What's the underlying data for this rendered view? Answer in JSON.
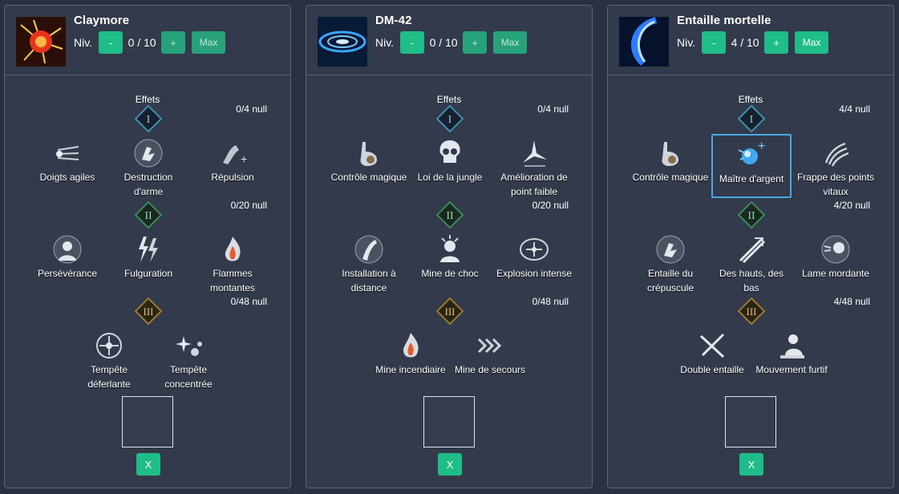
{
  "panels": [
    {
      "name": "Claymore",
      "level_label": "Niv.",
      "level": "0 / 10",
      "minus": "-",
      "plus": "+",
      "max": "Max",
      "effects": "Effets",
      "tiers": [
        {
          "numeral": "I",
          "count": "0/4 null",
          "options": [
            "Doigts agiles",
            "Destruction d'arme",
            "Répulsion"
          ]
        },
        {
          "numeral": "II",
          "count": "0/20 null",
          "options": [
            "Persévérance",
            "Fulguration",
            "Flammes montantes"
          ]
        },
        {
          "numeral": "III",
          "count": "0/48 null",
          "options": [
            "Tempête déferlante",
            "Tempête concentrée"
          ]
        }
      ],
      "clear": "X"
    },
    {
      "name": "DM-42",
      "level_label": "Niv.",
      "level": "0 / 10",
      "minus": "-",
      "plus": "+",
      "max": "Max",
      "effects": "Effets",
      "tiers": [
        {
          "numeral": "I",
          "count": "0/4 null",
          "options": [
            "Contrôle magique",
            "Loi de la jungle",
            "Amélioration de point faible"
          ]
        },
        {
          "numeral": "II",
          "count": "0/20 null",
          "options": [
            "Installation à distance",
            "Mine de choc",
            "Explosion intense"
          ]
        },
        {
          "numeral": "III",
          "count": "0/48 null",
          "options": [
            "Mine incendiaire",
            "Mine de secours"
          ]
        }
      ],
      "clear": "X"
    },
    {
      "name": "Entaille mortelle",
      "level_label": "Niv.",
      "level": "4 / 10",
      "minus": "-",
      "plus": "+",
      "max": "Max",
      "effects": "Effets",
      "tiers": [
        {
          "numeral": "I",
          "count": "4/4 null",
          "options": [
            "Contrôle magique",
            "Maître d'argent",
            "Frappe des points vitaux"
          ]
        },
        {
          "numeral": "II",
          "count": "4/20 null",
          "options": [
            "Entaille du crépuscule",
            "Des hauts, des bas",
            "Lame mordante"
          ]
        },
        {
          "numeral": "III",
          "count": "4/48 null",
          "options": [
            "Double entaille",
            "Mouvement furtif"
          ]
        }
      ],
      "clear": "X"
    }
  ],
  "colors": {
    "button": "#27a27a",
    "button_active": "#1fbd88",
    "selected_border": "#49a9e4",
    "tier1": "#3f8fb0",
    "tier2": "#3c8a58",
    "tier3": "#9a7a2e"
  }
}
